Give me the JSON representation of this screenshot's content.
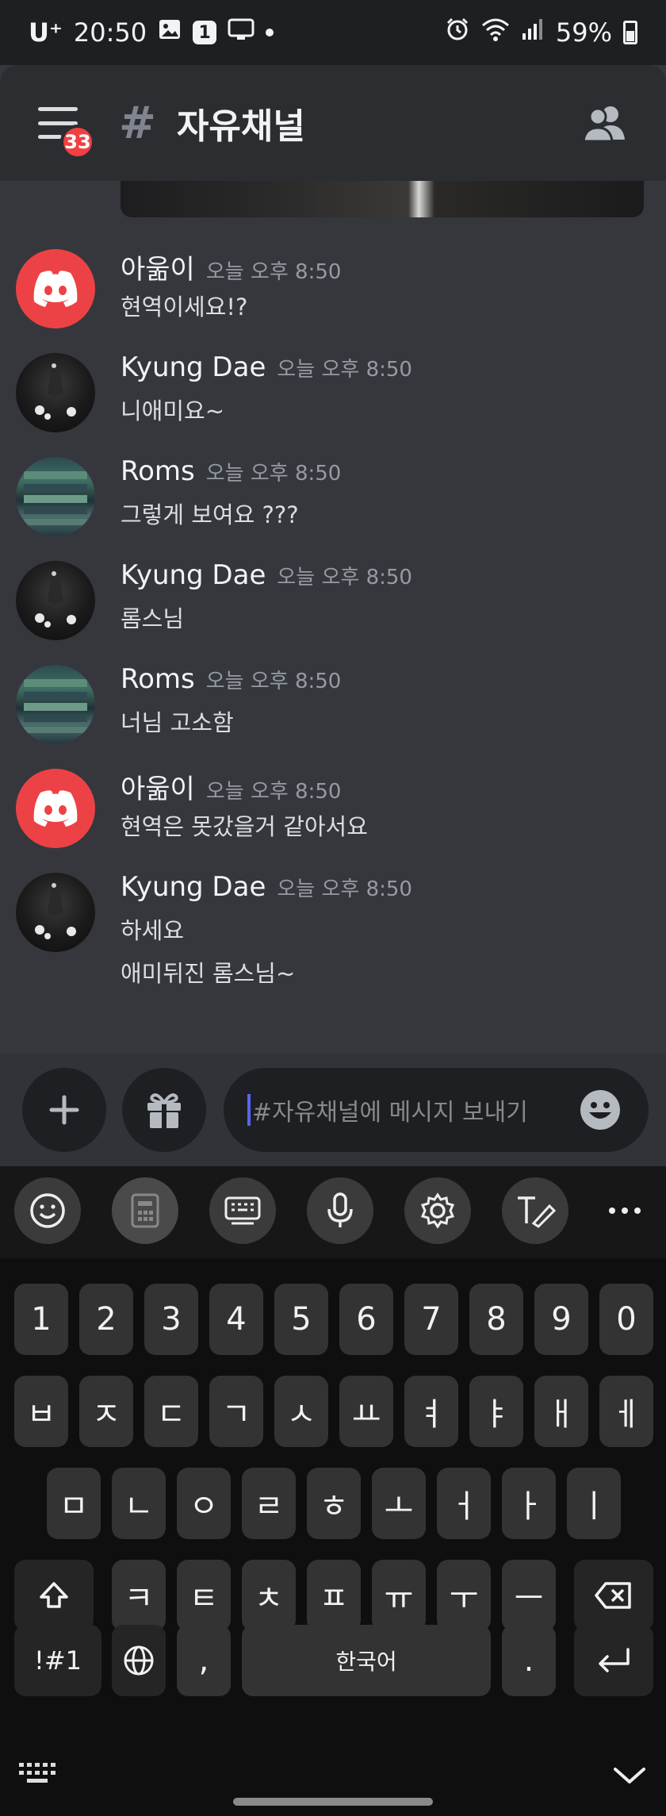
{
  "status_bar": {
    "carrier": "U⁺",
    "time": "20:50",
    "notification_count": "1",
    "battery": "59%"
  },
  "header": {
    "hash_symbol": "#",
    "channel_name": "자유채널",
    "unread_badge": "33"
  },
  "messages": [
    {
      "author": "아욺이",
      "time": "오늘 오후 8:50",
      "lines": [
        "현역이세요!?"
      ],
      "avatar": "discord-default"
    },
    {
      "author": "Kyung Dae",
      "time": "오늘 오후 8:50",
      "lines": [
        "니애미요~"
      ],
      "avatar": "dark"
    },
    {
      "author": "Roms",
      "time": "오늘 오후 8:50",
      "lines": [
        "그렇게 보여요 ???"
      ],
      "avatar": "roms"
    },
    {
      "author": "Kyung Dae",
      "time": "오늘 오후 8:50",
      "lines": [
        "롬스님"
      ],
      "avatar": "dark"
    },
    {
      "author": "Roms",
      "time": "오늘 오후 8:50",
      "lines": [
        "너님 고소함"
      ],
      "avatar": "roms"
    },
    {
      "author": "아욺이",
      "time": "오늘 오후 8:50",
      "lines": [
        "현역은 못갔을거 같아서요"
      ],
      "avatar": "discord-default"
    },
    {
      "author": "Kyung Dae",
      "time": "오늘 오후 8:50",
      "lines": [
        "하세요",
        "애미뒤진 롬스님~"
      ],
      "avatar": "dark"
    }
  ],
  "composer": {
    "placeholder": "#자유채널에 메시지 보내기"
  },
  "keyboard": {
    "toolbar": [
      "emoji-icon",
      "clipboard-icon",
      "keyboard-icon",
      "microphone-icon",
      "settings-icon",
      "handwriting-icon",
      "more-icon"
    ],
    "row_numbers": [
      "1",
      "2",
      "3",
      "4",
      "5",
      "6",
      "7",
      "8",
      "9",
      "0"
    ],
    "row_1": [
      "ㅂ",
      "ㅈ",
      "ㄷ",
      "ㄱ",
      "ㅅ",
      "ㅛ",
      "ㅕ",
      "ㅑ",
      "ㅐ",
      "ㅔ"
    ],
    "row_2": [
      "ㅁ",
      "ㄴ",
      "ㅇ",
      "ㄹ",
      "ㅎ",
      "ㅗ",
      "ㅓ",
      "ㅏ",
      "ㅣ"
    ],
    "row_3": [
      "ㅋ",
      "ㅌ",
      "ㅊ",
      "ㅍ",
      "ㅠ",
      "ㅜ",
      "ㅡ"
    ],
    "symbols_label": "!#1",
    "comma_label": ",",
    "space_label": "한국어",
    "period_label": "."
  }
}
